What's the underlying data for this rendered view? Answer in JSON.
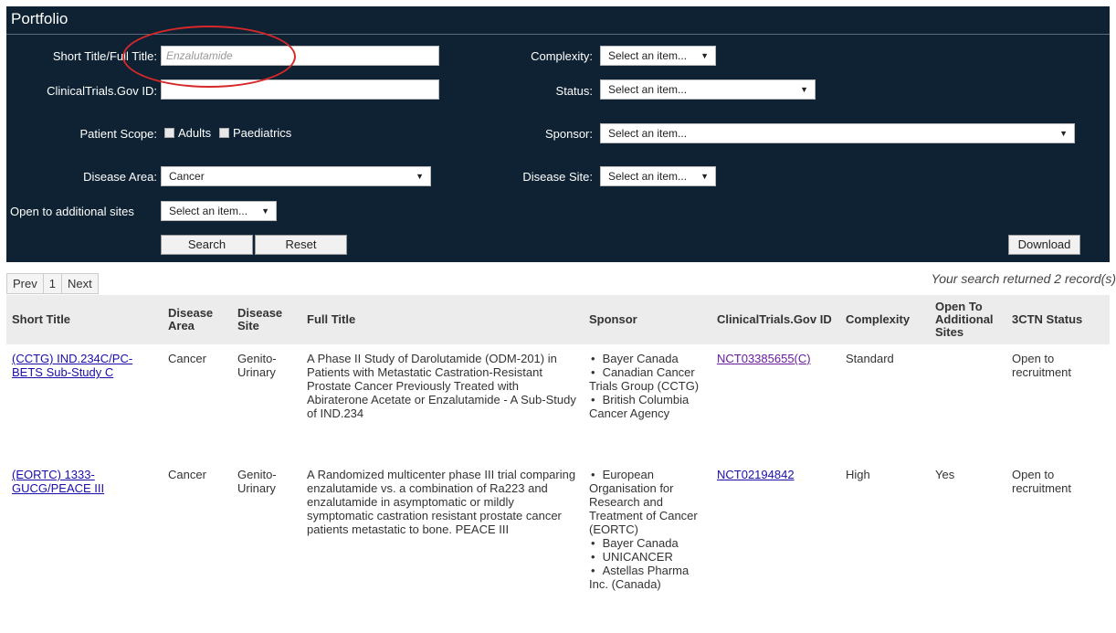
{
  "panel": {
    "title": "Portfolio",
    "short_title_label": "Short Title/Full Title:",
    "short_title_placeholder": "Enzalutamide",
    "ctgov_label": "ClinicalTrials.Gov ID:",
    "ctgov_value": "",
    "patient_scope_label": "Patient Scope:",
    "adults_label": "Adults",
    "paediatrics_label": "Paediatrics",
    "disease_area_label": "Disease Area:",
    "disease_area_value": "Cancer",
    "open_sites_label": "Open to additional sites",
    "open_sites_value": "Select an item...",
    "complexity_label": "Complexity:",
    "complexity_value": "Select an item...",
    "status_label": "Status:",
    "status_value": "Select an item...",
    "sponsor_label": "Sponsor:",
    "sponsor_value": "Select an item...",
    "disease_site_label": "Disease Site:",
    "disease_site_value": "Select an item...",
    "search_label": "Search",
    "reset_label": "Reset",
    "download_label": "Download"
  },
  "pager": {
    "prev": "Prev",
    "page": "1",
    "next": "Next"
  },
  "record_count": "Your search returned 2 record(s)",
  "table": {
    "headers": {
      "short_title": "Short Title",
      "disease_area": "Disease Area",
      "disease_site": "Disease Site",
      "full_title": "Full Title",
      "sponsor": "Sponsor",
      "ctgov_id": "ClinicalTrials.Gov ID",
      "complexity": "Complexity",
      "open_sites": "Open To Additional Sites",
      "status": "3CTN Status"
    },
    "rows": [
      {
        "short_title": "(CCTG) IND.234C/PC-BETS Sub-Study C",
        "disease_area": "Cancer",
        "disease_site": "Genito-Urinary",
        "full_title": "A Phase II Study of Darolutamide (ODM-201) in Patients with Metastatic Castration-Resistant Prostate Cancer Previously Treated with Abiraterone Acetate or Enzalutamide - A Sub-Study of IND.234",
        "sponsors": [
          "Bayer Canada",
          "Canadian Cancer Trials Group (CCTG)",
          "British Columbia Cancer Agency"
        ],
        "ctgov_id": "NCT03385655(C)",
        "complexity": "Standard",
        "open_sites": "",
        "status": "Open to recruitment"
      },
      {
        "short_title": "(EORTC) 1333-GUCG/PEACE III",
        "disease_area": "Cancer",
        "disease_site": "Genito-Urinary",
        "full_title": "A Randomized multicenter phase III trial comparing enzalutamide vs. a combination of Ra223 and enzalutamide in asymptomatic or mildly symptomatic castration resistant prostate cancer patients metastatic to bone. PEACE III",
        "sponsors": [
          "European Organisation for Research and Treatment of Cancer (EORTC)",
          "Bayer Canada",
          "UNICANCER",
          "Astellas Pharma Inc. (Canada)"
        ],
        "ctgov_id": "NCT02194842",
        "complexity": "High",
        "open_sites": "Yes",
        "status": "Open to recruitment"
      }
    ]
  }
}
